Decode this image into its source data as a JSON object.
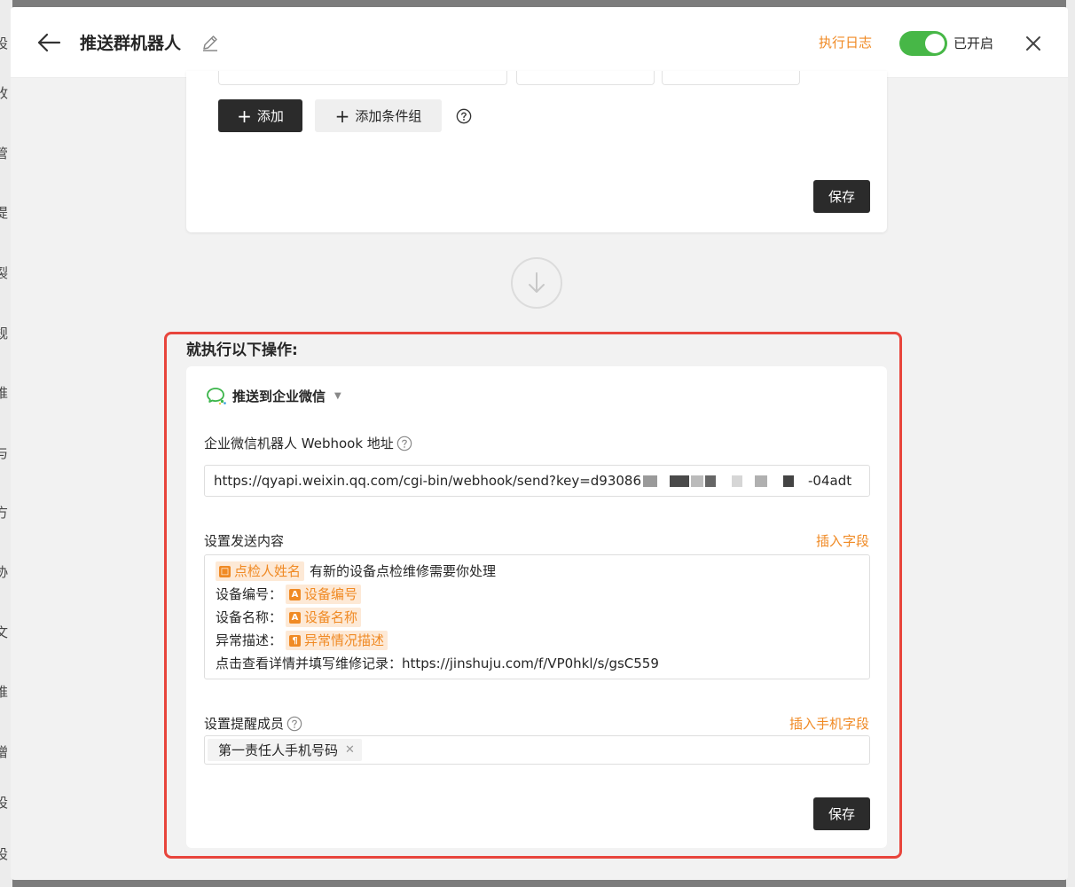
{
  "header": {
    "title": "推送群机器人",
    "log_link": "执行日志",
    "toggle_label": "已开启",
    "toggle_on": true
  },
  "background": {
    "left_chars": [
      "设",
      "收",
      "管",
      "提",
      "裂",
      "规",
      "推",
      "与",
      "方",
      "协",
      "文",
      "推",
      "增",
      "设",
      "设"
    ]
  },
  "conditions": {
    "add_label": "添加",
    "add_group_label": "添加条件组",
    "save_label": "保存"
  },
  "action": {
    "heading": "就执行以下操作:",
    "channel_label": "推送到企业微信",
    "webhook_label": "企业微信机器人 Webhook 地址",
    "webhook_value_start": "https://qyapi.weixin.qq.com/cgi-bin/webhook/send?key=d93086",
    "webhook_value_end": "-04adt",
    "content_label": "设置发送内容",
    "insert_field": "插入字段",
    "content": {
      "line1_field": "点检人姓名",
      "line1_text": "有新的设备点检维修需要你处理",
      "line2_label": "设备编号：",
      "line2_field": "设备编号",
      "line3_label": "设备名称：",
      "line3_field": "设备名称",
      "line4_label": "异常描述：",
      "line4_field": "异常情况描述",
      "line5": "点击查看详情并填写维修记录：https://jinshuju.com/f/VP0hkl/s/gsC559"
    },
    "members_label": "设置提醒成员",
    "insert_phone_field": "插入手机字段",
    "member_chip": "第一责任人手机号码",
    "save_label": "保存"
  },
  "colors": {
    "accent_orange": "#f08a24",
    "toggle_green": "#47b747",
    "highlight_red": "#e8453c",
    "dark_button": "#2b2b2b"
  }
}
